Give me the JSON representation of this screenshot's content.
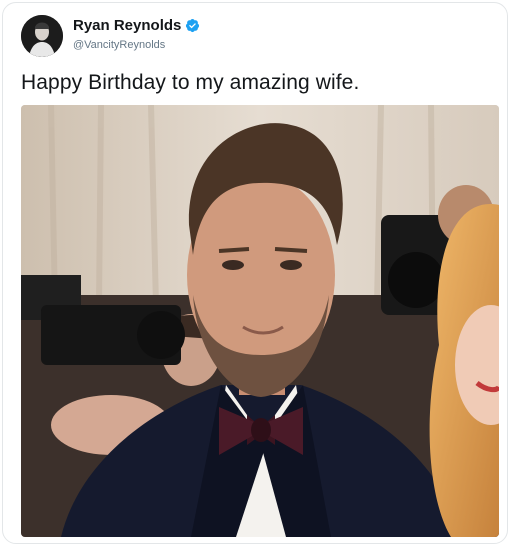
{
  "tweet": {
    "author_name": "Ryan Reynolds",
    "author_handle": "@VancityReynolds",
    "verified": true,
    "text": "Happy Birthday to my amazing wife."
  },
  "icons": {
    "verified": "verified-badge-icon",
    "avatar": "profile-avatar"
  },
  "colors": {
    "verified_blue": "#1da1f2",
    "name_text": "#14171a",
    "handle_text": "#657786"
  },
  "media": {
    "type": "photo"
  }
}
